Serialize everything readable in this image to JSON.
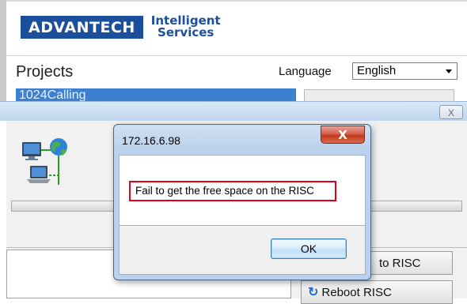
{
  "app": {
    "brand_name": "ADVANTECH",
    "brand_tagline_line1": "Intelligent",
    "brand_tagline_line2": "Services",
    "projects_label": "Projects",
    "language_label": "Language",
    "language_value": "English",
    "selected_project": "1024Calling"
  },
  "background_dialog": {
    "close_glyph": "X",
    "buttons": {
      "to_risc": "to RISC",
      "reboot_risc": "Reboot RISC"
    }
  },
  "message_box": {
    "title": "172.16.6.98",
    "close_glyph": "X",
    "message": "Fail to get the free space on the RISC",
    "ok_label": "OK"
  },
  "colors": {
    "brand_blue": "#1b4e9b",
    "highlight_red": "#e2001a",
    "close_red": "#c3391c"
  }
}
